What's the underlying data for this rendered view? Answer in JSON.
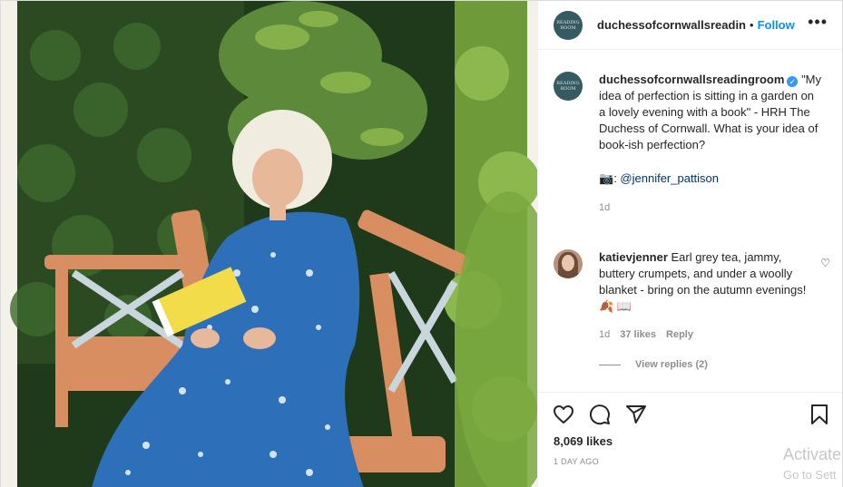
{
  "header": {
    "username": "duchessofcornwallsreadin",
    "separator": "•",
    "follow_label": "Follow",
    "more_icon": "more-horizontal-icon",
    "avatar_text": "READING ROOM"
  },
  "caption": {
    "username": "duchessofcornwallsreadingroom",
    "verified_mark": "✓",
    "text": "\"My idea of perfection is sitting in a garden on a lovely evening with a book\" - HRH The Duchess of Cornwall. What is your idea of book-ish perfection?",
    "credit_emoji": "📷",
    "credit_sep": ": ",
    "mention": "@jennifer_pattison",
    "time": "1d"
  },
  "comment": {
    "username": "katievjenner",
    "text": "Earl grey tea, jammy, buttery crumpets, and under a woolly blanket - bring on the autumn evenings! 🍂 📖",
    "time": "1d",
    "likes": "37 likes",
    "reply_label": "Reply",
    "view_replies": "View replies (2)",
    "heart": "♡"
  },
  "actions": {
    "like_icon": "heart-icon",
    "comment_icon": "comment-icon",
    "share_icon": "share-icon",
    "save_icon": "bookmark-icon",
    "likes_count": "8,069 likes",
    "date": "1 DAY AGO"
  },
  "overlay": {
    "activate": "Activate",
    "goto": "Go to Sett"
  }
}
